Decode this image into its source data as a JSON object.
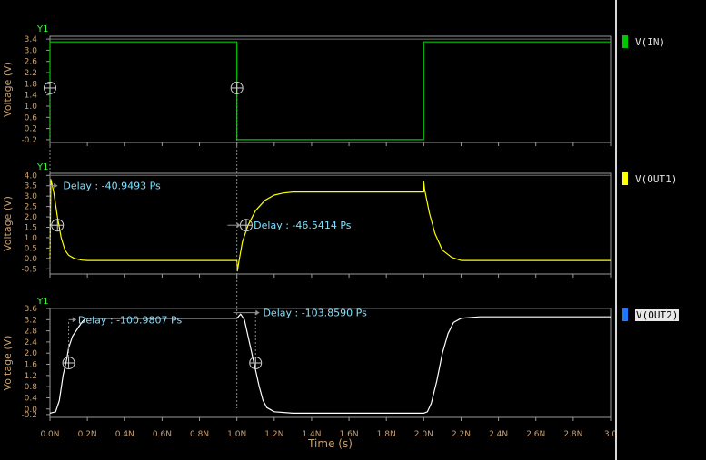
{
  "chart_data": {
    "type": "line",
    "xlabel": "Time (s)",
    "x_ticks": [
      "0.0N",
      "0.2N",
      "0.4N",
      "0.6N",
      "0.8N",
      "1.0N",
      "1.2N",
      "1.4N",
      "1.6N",
      "1.8N",
      "2.0N",
      "2.2N",
      "2.4N",
      "2.6N",
      "2.8N",
      "3.0"
    ],
    "xlim": [
      0,
      3.0
    ],
    "x_unit": "ns",
    "panels": [
      {
        "name": "V(IN)",
        "axis_label": "Y1",
        "ylabel": "Voltage (V)",
        "ylim": [
          -0.3,
          3.5
        ],
        "yticks": [
          "3.4",
          "3.0",
          "2.6",
          "2.2",
          "1.8",
          "1.4",
          "1.0",
          "0.6",
          "0.2",
          "-0.2"
        ],
        "ytick_values": [
          3.4,
          3.0,
          2.6,
          2.2,
          1.8,
          1.4,
          1.0,
          0.6,
          0.2,
          -0.2
        ],
        "color": "#00c800",
        "series": [
          {
            "name": "V(IN)",
            "x": [
              0.0,
              0.0,
              1.0,
              1.0,
              2.0,
              2.0,
              3.0
            ],
            "y": [
              -0.2,
              3.3,
              3.3,
              -0.2,
              -0.2,
              3.3,
              3.3
            ]
          }
        ]
      },
      {
        "name": "V(OUT1)",
        "axis_label": "Y1",
        "ylabel": "Voltage (V)",
        "ylim": [
          -0.75,
          4.1
        ],
        "yticks": [
          "4.0",
          "3.5",
          "3.0",
          "2.5",
          "2.0",
          "1.5",
          "1.0",
          "0.5",
          "0.0",
          "-0.5"
        ],
        "ytick_values": [
          4.0,
          3.5,
          3.0,
          2.5,
          2.0,
          1.5,
          1.0,
          0.5,
          0.0,
          -0.5
        ],
        "color": "#ffff00",
        "series": [
          {
            "name": "V(OUT1)",
            "x": [
              0.0,
              0.005,
              0.02,
              0.04,
              0.06,
              0.08,
              0.1,
              0.13,
              0.17,
              0.2,
              0.3,
              1.0,
              1.003,
              1.01,
              1.03,
              1.06,
              1.1,
              1.15,
              1.2,
              1.25,
              1.3,
              1.4,
              2.0,
              2.0,
              2.005,
              2.03,
              2.06,
              2.1,
              2.15,
              2.2,
              3.0
            ],
            "y": [
              0.0,
              3.8,
              3.2,
              2.0,
              1.0,
              0.4,
              0.15,
              0.0,
              -0.08,
              -0.1,
              -0.1,
              -0.1,
              -0.6,
              -0.2,
              0.8,
              1.6,
              2.3,
              2.8,
              3.05,
              3.15,
              3.2,
              3.2,
              3.2,
              3.7,
              3.3,
              2.2,
              1.2,
              0.4,
              0.05,
              -0.1,
              -0.1
            ]
          }
        ]
      },
      {
        "name": "V(OUT2)",
        "axis_label": "Y1",
        "ylabel": "Voltage (V)",
        "ylim": [
          -0.3,
          3.6
        ],
        "yticks": [
          "3.6",
          "3.2",
          "2.8",
          "2.4",
          "2.0",
          "1.6",
          "1.2",
          "0.8",
          "0.4",
          "0.0",
          "-0.2"
        ],
        "ytick_values": [
          3.6,
          3.2,
          2.8,
          2.4,
          2.0,
          1.6,
          1.2,
          0.8,
          0.4,
          0.0,
          -0.2
        ],
        "color": "#ffffff",
        "series": [
          {
            "name": "V(OUT2)",
            "x": [
              0.0,
              0.03,
              0.05,
              0.07,
              0.09,
              0.1,
              0.12,
              0.15,
              0.17,
              0.19,
              1.0,
              1.02,
              1.04,
              1.06,
              1.08,
              1.1,
              1.12,
              1.14,
              1.16,
              1.2,
              1.3,
              1.5,
              2.0,
              2.02,
              2.04,
              2.07,
              2.1,
              2.13,
              2.16,
              2.2,
              2.3,
              3.0
            ],
            "y": [
              -0.15,
              -0.1,
              0.3,
              1.2,
              1.8,
              2.2,
              2.6,
              2.9,
              3.1,
              3.25,
              3.25,
              3.4,
              3.2,
              2.6,
              2.0,
              1.4,
              0.8,
              0.3,
              0.05,
              -0.1,
              -0.15,
              -0.15,
              -0.15,
              -0.1,
              0.2,
              1.0,
              2.0,
              2.7,
              3.1,
              3.25,
              3.3,
              3.3
            ]
          }
        ]
      }
    ],
    "annotations": [
      {
        "panel": 1,
        "text": "Delay : -40.9493 Ps",
        "y": 3.5
      },
      {
        "panel": 1,
        "text": "Delay : -46.5414 Ps",
        "y": 1.6
      },
      {
        "panel": 2,
        "text": "Delay : -100.9807 Ps",
        "y": 3.2
      },
      {
        "panel": 2,
        "text": "Delay : -103.8590 Ps",
        "y": 3.45
      }
    ],
    "markers": [
      {
        "panel": 0,
        "x": 0.0,
        "y": 1.65
      },
      {
        "panel": 0,
        "x": 1.0,
        "y": 1.65
      },
      {
        "panel": 1,
        "x": 0.04,
        "y": 1.6
      },
      {
        "panel": 1,
        "x": 1.05,
        "y": 1.6
      },
      {
        "panel": 2,
        "x": 0.1,
        "y": 1.65
      },
      {
        "panel": 2,
        "x": 1.1,
        "y": 1.65
      }
    ],
    "delay_links": [
      {
        "x": 0.0,
        "from_panel": 0,
        "to_panel": 1
      },
      {
        "x": 1.0,
        "from_panel": 0,
        "to_panel": 2
      }
    ],
    "legend": [
      {
        "label": "V(IN)",
        "color": "#00c800",
        "selected": false
      },
      {
        "label": "V(OUT1)",
        "color": "#ffff00",
        "selected": false
      },
      {
        "label": "V(OUT2)",
        "color": "#1e78ff",
        "selected": true
      }
    ]
  }
}
